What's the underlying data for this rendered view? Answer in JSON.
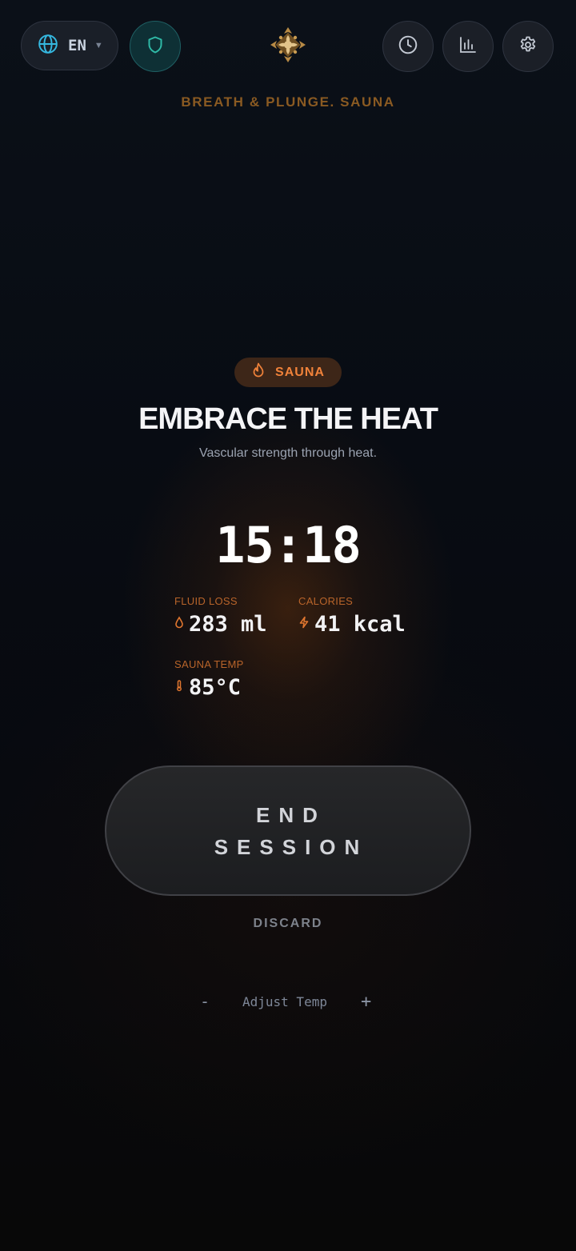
{
  "header": {
    "language_code": "EN",
    "brand_text": "BREATH & PLUNGE. SAUNA"
  },
  "mode": {
    "badge_label": "SAUNA",
    "headline": "EMBRACE THE HEAT",
    "subtitle": "Vascular strength through heat."
  },
  "session": {
    "timer": "15:18",
    "stats": {
      "fluid_loss": {
        "label": "FLUID LOSS",
        "value": "283 ml"
      },
      "calories": {
        "label": "CALORIES",
        "value": "41 kcal"
      },
      "sauna_temp": {
        "label": "SAUNA TEMP",
        "value": "85°C"
      }
    }
  },
  "actions": {
    "end_session_label": "END SESSION",
    "discard_label": "DISCARD"
  },
  "temp_control": {
    "minus": "-",
    "label": "Adjust Temp",
    "plus": "+"
  },
  "icons": {
    "language": "globe-icon",
    "privacy": "shield-icon",
    "history": "clock-icon",
    "stats": "bar-chart-icon",
    "settings": "gear-icon",
    "logo": "ornament-logo",
    "mode": "flame-icon",
    "fluid": "droplet-icon",
    "calories": "bolt-icon",
    "temp": "thermometer-icon"
  },
  "colors": {
    "accent_orange": "#f0823a",
    "brand_gold": "#8a5a22",
    "teal": "#2fb9a6",
    "cyan": "#35b8e0"
  }
}
